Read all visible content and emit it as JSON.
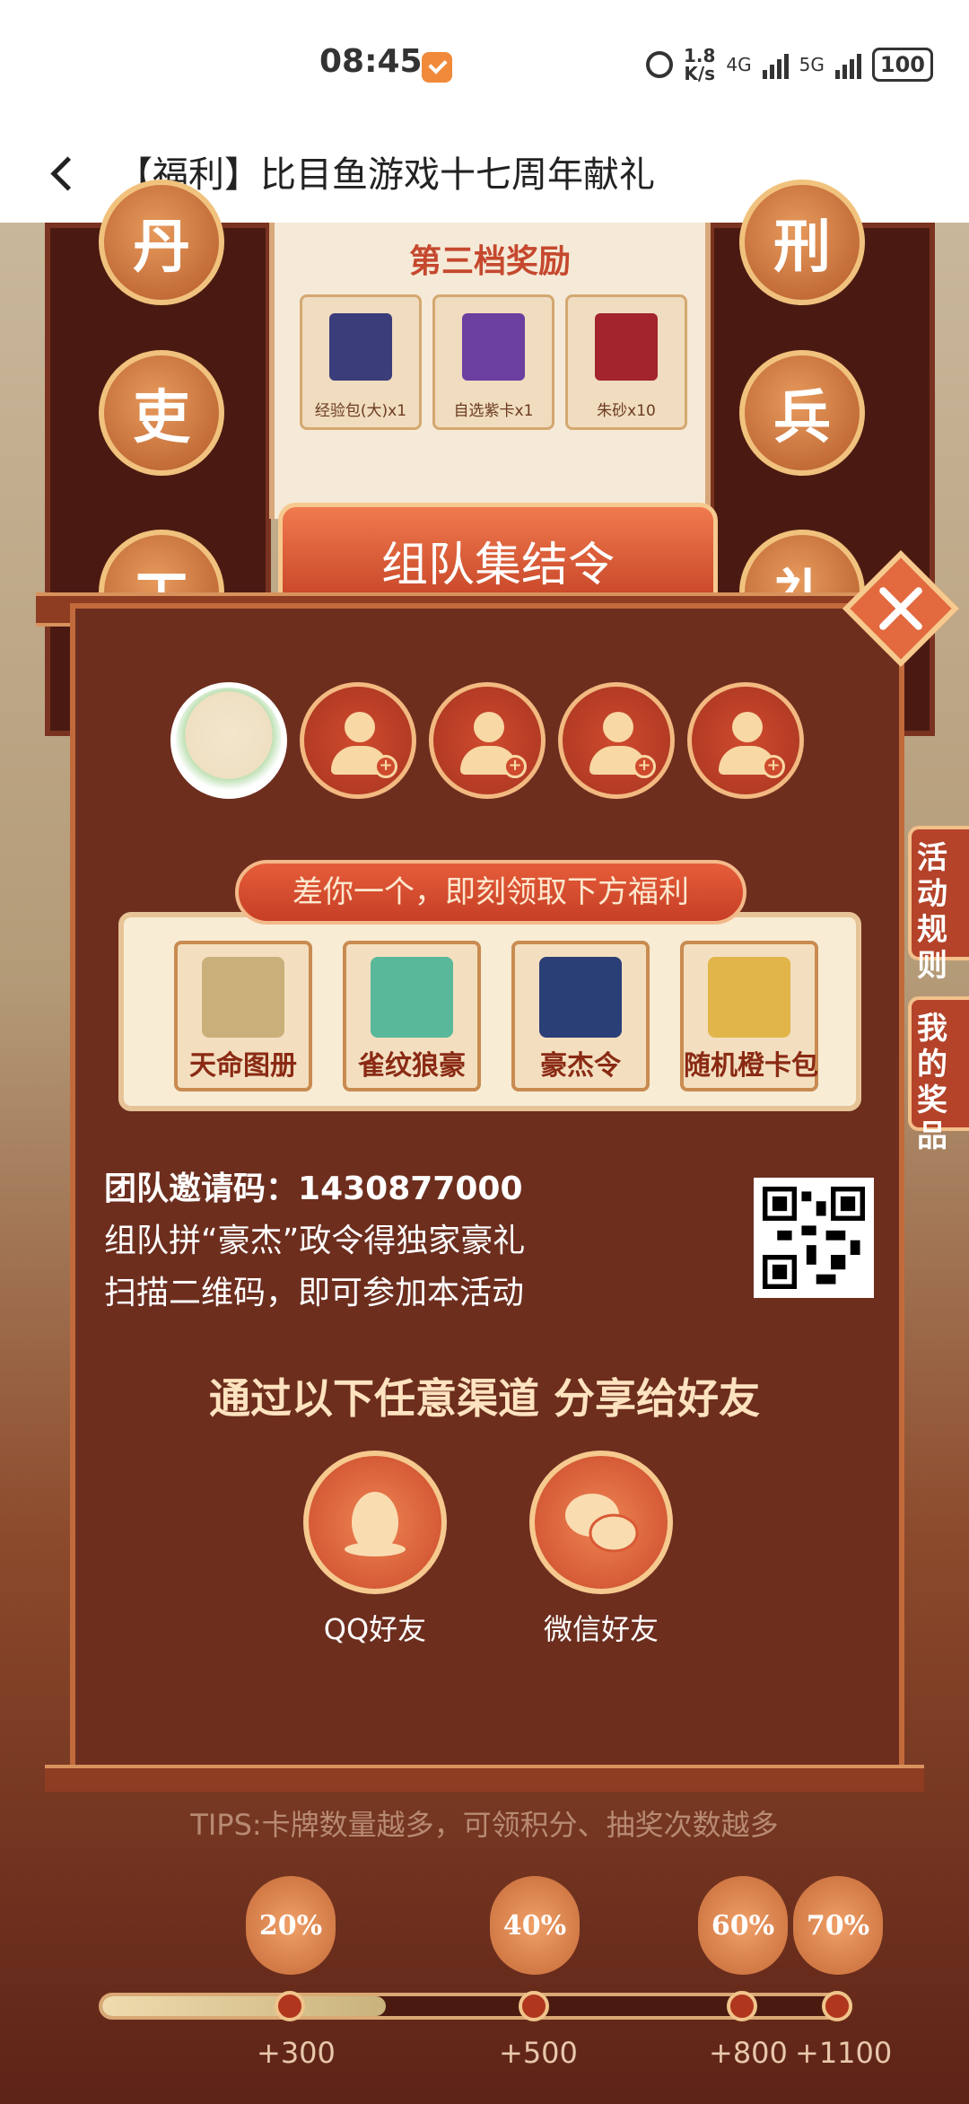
{
  "status_bar": {
    "time": "08:45",
    "net_speed_top": "1.8",
    "net_speed_unit": "K/s",
    "signal_1": "4G",
    "signal_2": "5G",
    "battery": "100"
  },
  "nav": {
    "title": "【福利】比目鱼游戏十七周年献礼",
    "back_icon": "chevron-left-icon"
  },
  "background": {
    "pillar_chars_left": [
      "丹",
      "吏",
      "工"
    ],
    "pillar_chars_right": [
      "刑",
      "兵",
      "礼"
    ],
    "tier_title": "第三档奖励",
    "tier_items": [
      {
        "label": "经验包(大)x1",
        "color": "#3a3d7a"
      },
      {
        "label": "自选紫卡x1",
        "color": "#6b3fa0"
      },
      {
        "label": "朱砂x10",
        "color": "#a3242b"
      }
    ],
    "side_tabs": [
      "活动规则",
      "我的奖品"
    ]
  },
  "modal": {
    "banner_title": "组队集结令",
    "close_icon": "close-icon",
    "avatar_icon": "user-add-icon",
    "pill_text": "差你一个，即刻领取下方福利",
    "rewards": [
      {
        "label": "天命图册",
        "color": "#c9b07a"
      },
      {
        "label": "雀纹狼豪",
        "color": "#59b89a"
      },
      {
        "label": "豪杰令",
        "color": "#2b3f77"
      },
      {
        "label": "随机橙卡包",
        "color": "#e1b54a"
      }
    ],
    "invite_label": "团队邀请码：",
    "invite_code": "1430877000",
    "invite_line2": "组队拼“豪杰”政令得独家豪礼",
    "invite_line3": "扫描二维码，即可参加本活动",
    "share_title": "通过以下任意渠道 分享给好友",
    "share_buttons": [
      {
        "label": "QQ好友",
        "icon": "qq-icon"
      },
      {
        "label": "微信好友",
        "icon": "wechat-icon"
      }
    ]
  },
  "progress": {
    "tips": "TIPS:卡牌数量越多，可领积分、抽奖次数越多",
    "fraction": 0.38,
    "milestones": [
      {
        "percent": "20%",
        "points": "+300"
      },
      {
        "percent": "40%",
        "points": "+500"
      },
      {
        "percent": "60%",
        "points": "+800"
      },
      {
        "percent": "70%",
        "points": "+1100"
      }
    ]
  }
}
